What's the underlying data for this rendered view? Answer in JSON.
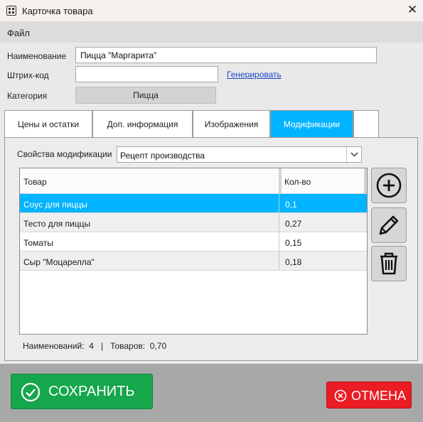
{
  "window": {
    "title": "Карточка товара",
    "close_label": "✕"
  },
  "menu": {
    "file": "Файл"
  },
  "form": {
    "name_label": "Наименование",
    "name_value": "Пицца \"Маргарита\"",
    "barcode_label": "Штрих-код",
    "barcode_value": "",
    "generate_link": "Генерировать",
    "category_label": "Категория",
    "category_value": "Пицца"
  },
  "tabs": [
    {
      "label": "Цены и остатки",
      "active": false
    },
    {
      "label": "Доп. информация",
      "active": false
    },
    {
      "label": "Изображения",
      "active": false
    },
    {
      "label": "Модификации",
      "active": true
    },
    {
      "label": "",
      "active": false
    }
  ],
  "modifications": {
    "property_label": "Свойства модификации",
    "property_value": "Рецепт производства",
    "columns": {
      "product": "Товар",
      "qty": "Кол-во"
    },
    "rows": [
      {
        "product": "Соус для пиццы",
        "qty": "0,1",
        "selected": true
      },
      {
        "product": "Тесто для пиццы",
        "qty": "0,27",
        "selected": false
      },
      {
        "product": "Томаты",
        "qty": "0,15",
        "selected": false
      },
      {
        "product": "Сыр \"Моцарелла\"",
        "qty": "0,18",
        "selected": false
      }
    ],
    "status": {
      "names_label": "Наименований:",
      "names_count": "4",
      "separator": "|",
      "goods_label": "Товаров:",
      "goods_total": "0,70"
    }
  },
  "actions": {
    "add_icon": "plus-circle-icon",
    "edit_icon": "pencil-icon",
    "delete_icon": "trash-icon",
    "save_label": "СОХРАНИТЬ",
    "cancel_label": "ОТМЕНА"
  },
  "colors": {
    "accent": "#00b4ff",
    "save": "#16a64c",
    "cancel": "#ea1c24",
    "link": "#1a46c8"
  }
}
